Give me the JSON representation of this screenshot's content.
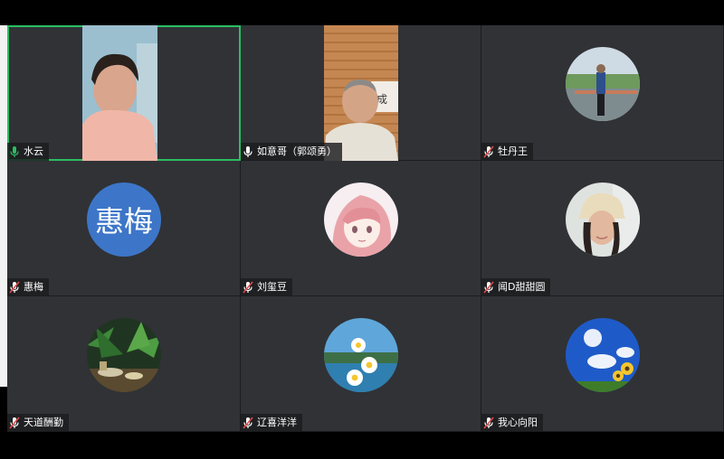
{
  "meeting": {
    "participants": [
      {
        "name": "水云",
        "mic": "on",
        "view": "video",
        "active": true
      },
      {
        "name": "如意哥（郭颂勇）",
        "mic": "on",
        "view": "video",
        "active": false
      },
      {
        "name": "牡丹王",
        "mic": "muted",
        "view": "avatar-photo",
        "active": false
      },
      {
        "name": "惠梅",
        "mic": "muted",
        "view": "avatar-text",
        "avatar_text": "惠梅",
        "active": false
      },
      {
        "name": "刘玺豆",
        "mic": "muted",
        "view": "avatar-photo",
        "active": false
      },
      {
        "name": "闻D甜甜圆",
        "mic": "muted",
        "view": "avatar-photo",
        "active": false
      },
      {
        "name": "天道酬勤",
        "mic": "muted",
        "view": "avatar-photo",
        "active": false
      },
      {
        "name": "辽喜洋洋",
        "mic": "muted",
        "view": "avatar-photo",
        "active": false
      },
      {
        "name": "我心向阳",
        "mic": "muted",
        "view": "avatar-photo",
        "active": false
      }
    ]
  },
  "colors": {
    "tile_bg": "#303236",
    "active_border": "#2bbd62",
    "mic_on": "#2bbd62",
    "mic_muted": "#e24a4a",
    "avatar_text_bg": "#3d76c8"
  },
  "icons": {
    "mic_on": "microphone-icon",
    "mic_muted": "microphone-muted-icon"
  }
}
